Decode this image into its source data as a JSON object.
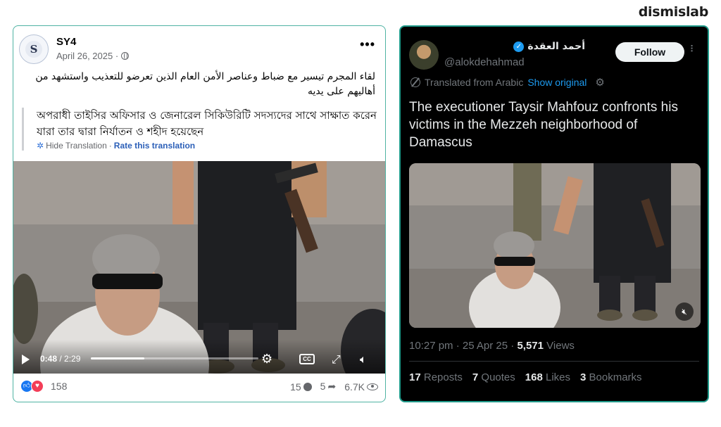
{
  "brand": "dismislab",
  "facebook": {
    "page_name": "SY4",
    "avatar_letter": "S",
    "date": "April 26, 2025 ·",
    "more_label": "•••",
    "arabic_text": "لقاء المجرم تيسير مع ضباط وعناصر الأمن العام الذين تعرضو للتعذيب واستشهد من أهاليهم على يديه",
    "translation_text": "অপরাধী তাইসির অফিসার ও জেনারেল সিকিউরিটি সদস্যদের সাথে সাক্ষাত করেন যারা তার দ্বারা নির্যাতন ও শহীদ হয়েছেন",
    "hide_translation": "Hide Translation",
    "separator": "·",
    "rate_translation": "Rate this translation",
    "video": {
      "current_time": "0:48",
      "duration": "/ 2:29",
      "progress": 0.32,
      "cc_label": "CC"
    },
    "reactions_count": "158",
    "comments_count": "15",
    "shares_count": "5",
    "views_count": "6.7K"
  },
  "twitter": {
    "display_name": "أحمد العقدة",
    "verified_mark": "✓",
    "handle": "@alokdehahmad",
    "follow_label": "Follow",
    "more_label": "···",
    "translated_from": "Translated from Arabic",
    "show_original": "Show original",
    "text": "The executioner Taysir Mahfouz confronts his victims in the Mezzeh neighborhood of Damascus",
    "time": "10:27 pm · 25 Apr 25 ·",
    "views_number": "5,571",
    "views_label": "Views",
    "reposts_number": "17",
    "reposts_label": "Reposts",
    "quotes_number": "7",
    "quotes_label": "Quotes",
    "likes_number": "168",
    "likes_label": "Likes",
    "bookmarks_number": "3",
    "bookmarks_label": "Bookmarks"
  },
  "colors": {
    "facebook_blue": "#1877f2",
    "x_blue": "#1d9bf0",
    "card_border": "#4fb3a3"
  }
}
